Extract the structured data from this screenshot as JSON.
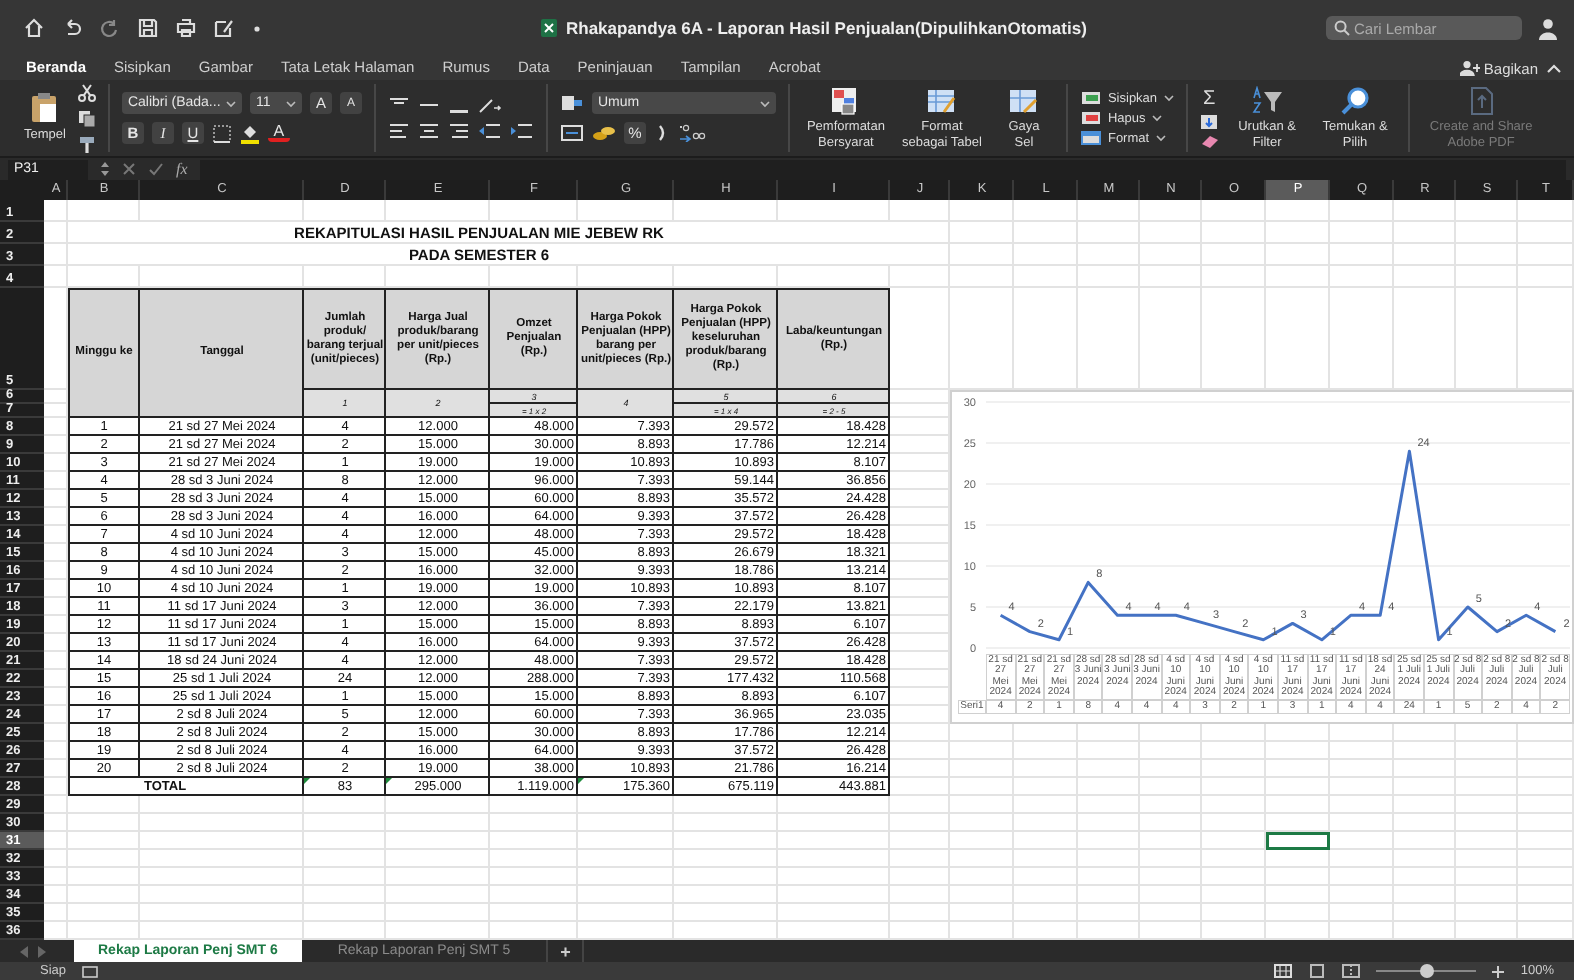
{
  "window": {
    "title": "Rhakapandya 6A - Laporan Hasil Penjualan(DipulihkanOtomatis)"
  },
  "search": {
    "placeholder": "Cari Lembar"
  },
  "ribbon_tabs": [
    {
      "label": "Beranda",
      "selected": true
    },
    {
      "label": "Sisipkan",
      "selected": false
    },
    {
      "label": "Gambar",
      "selected": false
    },
    {
      "label": "Tata Letak Halaman",
      "selected": false
    },
    {
      "label": "Rumus",
      "selected": false
    },
    {
      "label": "Data",
      "selected": false
    },
    {
      "label": "Peninjauan",
      "selected": false
    },
    {
      "label": "Tampilan",
      "selected": false
    },
    {
      "label": "Acrobat",
      "selected": false
    }
  ],
  "share_button": "Bagikan",
  "ribbon": {
    "paste": "Tempel",
    "font_name": "Calibri (Bada...",
    "font_size": "11",
    "grow_font": "A",
    "shrink_font": "A",
    "bold": "B",
    "italic": "I",
    "underline": "U",
    "font_color": "A",
    "number_format": "Umum",
    "percent": "%",
    "styles": [
      "Pemformatan Bersyarat",
      "Format sebagai Tabel",
      "Gaya Sel"
    ],
    "cells": [
      "Sisipkan",
      "Hapus",
      "Format"
    ],
    "autosum": "Σ",
    "editing": [
      "Urutkan & Filter",
      "Temukan & Pilih"
    ],
    "adobe": {
      "label": "Create and Share Adobe PDF",
      "disabled": true
    }
  },
  "formula_bar": {
    "cell": "P31",
    "fx": "fx"
  },
  "sheet": {
    "title": "REKAPITULASI HASIL PENJUALAN MIE JEBEW RK",
    "subtitle": "PADA SEMESTER 6",
    "columns": [
      {
        "label": "A",
        "selected": false
      },
      {
        "label": "B",
        "selected": false
      },
      {
        "label": "C",
        "selected": false
      },
      {
        "label": "D",
        "selected": false
      },
      {
        "label": "E",
        "selected": false
      },
      {
        "label": "F",
        "selected": false
      },
      {
        "label": "G",
        "selected": false
      },
      {
        "label": "H",
        "selected": false
      },
      {
        "label": "I",
        "selected": false
      },
      {
        "label": "J",
        "selected": false
      },
      {
        "label": "K",
        "selected": false
      },
      {
        "label": "L",
        "selected": false
      },
      {
        "label": "M",
        "selected": false
      },
      {
        "label": "N",
        "selected": false
      },
      {
        "label": "O",
        "selected": false
      },
      {
        "label": "P",
        "selected": true
      },
      {
        "label": "Q",
        "selected": false
      },
      {
        "label": "R",
        "selected": false
      },
      {
        "label": "S",
        "selected": false
      },
      {
        "label": "T",
        "selected": false
      }
    ],
    "rows": [
      {
        "label": "1",
        "selected": false
      },
      {
        "label": "2",
        "selected": false
      },
      {
        "label": "3",
        "selected": false
      },
      {
        "label": "4",
        "selected": false
      },
      {
        "label": "5",
        "selected": false
      },
      {
        "label": "6",
        "selected": false
      },
      {
        "label": "7",
        "selected": false
      },
      {
        "label": "8",
        "selected": false
      },
      {
        "label": "9",
        "selected": false
      },
      {
        "label": "10",
        "selected": false
      },
      {
        "label": "11",
        "selected": false
      },
      {
        "label": "12",
        "selected": false
      },
      {
        "label": "13",
        "selected": false
      },
      {
        "label": "14",
        "selected": false
      },
      {
        "label": "15",
        "selected": false
      },
      {
        "label": "16",
        "selected": false
      },
      {
        "label": "17",
        "selected": false
      },
      {
        "label": "18",
        "selected": false
      },
      {
        "label": "19",
        "selected": false
      },
      {
        "label": "20",
        "selected": false
      },
      {
        "label": "21",
        "selected": false
      },
      {
        "label": "22",
        "selected": false
      },
      {
        "label": "23",
        "selected": false
      },
      {
        "label": "24",
        "selected": false
      },
      {
        "label": "25",
        "selected": false
      },
      {
        "label": "26",
        "selected": false
      },
      {
        "label": "27",
        "selected": false
      },
      {
        "label": "28",
        "selected": false
      },
      {
        "label": "29",
        "selected": false
      },
      {
        "label": "30",
        "selected": false
      },
      {
        "label": "31",
        "selected": true
      },
      {
        "label": "32",
        "selected": false
      },
      {
        "label": "33",
        "selected": false
      },
      {
        "label": "34",
        "selected": false
      },
      {
        "label": "35",
        "selected": false
      },
      {
        "label": "36",
        "selected": false
      }
    ]
  },
  "table": {
    "columns": [
      {
        "header": "Minggu ke"
      },
      {
        "header": "Tanggal"
      },
      {
        "header": "Jumlah produk/ barang terjual (unit/pieces)",
        "number": "1"
      },
      {
        "header": "Harga Jual produk/barang per unit/pieces (Rp.)",
        "number": "2"
      },
      {
        "header": "Omzet Penjualan (Rp.)",
        "number": "3",
        "formula": "= 1 x 2"
      },
      {
        "header": "Harga Pokok Penjualan (HPP) barang per unit/pieces (Rp.)",
        "number": "4"
      },
      {
        "header": "Harga Pokok Penjualan (HPP) keseluruhan produk/barang (Rp.)",
        "number": "5",
        "formula": "= 1 x 4"
      },
      {
        "header": "Laba/keuntungan (Rp.)",
        "number": "6",
        "formula": "= 2 - 5"
      }
    ],
    "rows": [
      [
        "1",
        "21 sd 27 Mei 2024",
        "4",
        "12.000",
        "48.000",
        "7.393",
        "29.572",
        "18.428"
      ],
      [
        "2",
        "21 sd 27 Mei 2024",
        "2",
        "15.000",
        "30.000",
        "8.893",
        "17.786",
        "12.214"
      ],
      [
        "3",
        "21 sd 27 Mei 2024",
        "1",
        "19.000",
        "19.000",
        "10.893",
        "10.893",
        "8.107"
      ],
      [
        "4",
        "28 sd 3 Juni 2024",
        "8",
        "12.000",
        "96.000",
        "7.393",
        "59.144",
        "36.856"
      ],
      [
        "5",
        "28 sd 3 Juni 2024",
        "4",
        "15.000",
        "60.000",
        "8.893",
        "35.572",
        "24.428"
      ],
      [
        "6",
        "28 sd 3 Juni 2024",
        "4",
        "16.000",
        "64.000",
        "9.393",
        "37.572",
        "26.428"
      ],
      [
        "7",
        "4 sd 10 Juni 2024",
        "4",
        "12.000",
        "48.000",
        "7.393",
        "29.572",
        "18.428"
      ],
      [
        "8",
        "4 sd 10 Juni 2024",
        "3",
        "15.000",
        "45.000",
        "8.893",
        "26.679",
        "18.321"
      ],
      [
        "9",
        "4 sd 10 Juni 2024",
        "2",
        "16.000",
        "32.000",
        "9.393",
        "18.786",
        "13.214"
      ],
      [
        "10",
        "4 sd 10 Juni 2024",
        "1",
        "19.000",
        "19.000",
        "10.893",
        "10.893",
        "8.107"
      ],
      [
        "11",
        "11 sd 17 Juni 2024",
        "3",
        "12.000",
        "36.000",
        "7.393",
        "22.179",
        "13.821"
      ],
      [
        "12",
        "11 sd 17 Juni 2024",
        "1",
        "15.000",
        "15.000",
        "8.893",
        "8.893",
        "6.107"
      ],
      [
        "13",
        "11 sd 17 Juni 2024",
        "4",
        "16.000",
        "64.000",
        "9.393",
        "37.572",
        "26.428"
      ],
      [
        "14",
        "18 sd 24 Juni 2024",
        "4",
        "12.000",
        "48.000",
        "7.393",
        "29.572",
        "18.428"
      ],
      [
        "15",
        "25 sd 1 Juli 2024",
        "24",
        "12.000",
        "288.000",
        "7.393",
        "177.432",
        "110.568"
      ],
      [
        "16",
        "25 sd 1 Juli 2024",
        "1",
        "15.000",
        "15.000",
        "8.893",
        "8.893",
        "6.107"
      ],
      [
        "17",
        "2 sd 8 Juli 2024",
        "5",
        "12.000",
        "60.000",
        "7.393",
        "36.965",
        "23.035"
      ],
      [
        "18",
        "2 sd 8 Juli 2024",
        "2",
        "15.000",
        "30.000",
        "8.893",
        "17.786",
        "12.214"
      ],
      [
        "19",
        "2 sd 8 Juli 2024",
        "4",
        "16.000",
        "64.000",
        "9.393",
        "37.572",
        "26.428"
      ],
      [
        "20",
        "2 sd 8 Juli 2024",
        "2",
        "19.000",
        "38.000",
        "10.893",
        "21.786",
        "16.214"
      ]
    ],
    "total": {
      "label": "TOTAL",
      "values": [
        {
          "text": "83",
          "flagged": true
        },
        {
          "text": "295.000",
          "flagged": true
        },
        {
          "text": "1.119.000",
          "flagged": false
        },
        {
          "text": "175.360",
          "flagged": true
        },
        {
          "text": "675.119",
          "flagged": false
        },
        {
          "text": "443.881",
          "flagged": false
        }
      ]
    }
  },
  "chart": {
    "chart_data": {
      "type": "line",
      "categories": [
        "21 sd 27 Mei 2024",
        "21 sd 27 Mei 2024",
        "21 sd 27 Mei 2024",
        "28 sd 3 Juni 2024",
        "28 sd 3 Juni 2024",
        "28 sd 3 Juni 2024",
        "4 sd 10 Juni 2024",
        "4 sd 10 Juni 2024",
        "4 sd 10 Juni 2024",
        "4 sd 10 Juni 2024",
        "11 sd 17 Juni 2024",
        "11 sd 17 Juni 2024",
        "11 sd 17 Juni 2024",
        "18 sd 24 Juni 2024",
        "25 sd 1 Juli 2024",
        "25 sd 1 Juli 2024",
        "2 sd 8 Juli 2024",
        "2 sd 8 Juli 2024",
        "2 sd 8 Juli 2024",
        "2 sd 8 Juli 2024"
      ],
      "series": [
        {
          "name": "Seri1",
          "color": "#4472c4",
          "values": [
            4,
            2,
            1,
            8,
            4,
            4,
            4,
            3,
            2,
            1,
            3,
            1,
            4,
            4,
            24,
            1,
            5,
            2,
            4,
            2
          ]
        }
      ],
      "ylim": [
        0,
        30
      ],
      "yticks": [
        0,
        5,
        10,
        15,
        20,
        25,
        30
      ],
      "grid": true,
      "value_labels": [
        "4",
        "2",
        "1",
        "8",
        "4",
        "4",
        "4",
        "3",
        "2",
        "1",
        "3",
        "1",
        "4",
        "4",
        "24",
        "1",
        "5",
        "2",
        "4",
        "2"
      ]
    },
    "data_table_values": [
      "4",
      "2",
      "1",
      "8",
      "4",
      "4",
      "4",
      "3",
      "2",
      "1",
      "3",
      "1",
      "4",
      "4",
      "24",
      "1",
      "5",
      "2",
      "4",
      "2"
    ]
  },
  "sheet_tabs": [
    {
      "label": "Rekap Laporan Penj SMT 6",
      "selected": true
    },
    {
      "label": "Rekap Laporan Penj SMT 5",
      "selected": false
    }
  ],
  "add_sheet": "+",
  "status_bar": {
    "status": "Siap",
    "zoom": {
      "level": 0.5,
      "reading": "100%"
    }
  }
}
